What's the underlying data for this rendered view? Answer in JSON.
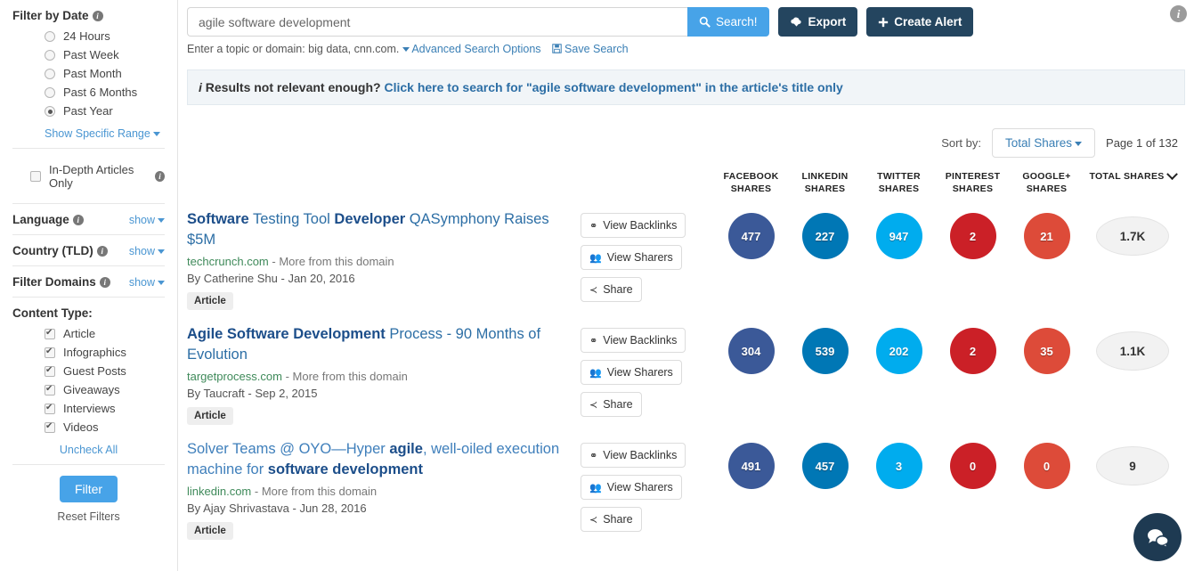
{
  "sidebar": {
    "date_filter": {
      "title": "Filter by Date",
      "options": [
        {
          "label": "24 Hours",
          "selected": false
        },
        {
          "label": "Past Week",
          "selected": false
        },
        {
          "label": "Past Month",
          "selected": false
        },
        {
          "label": "Past 6 Months",
          "selected": false
        },
        {
          "label": "Past Year",
          "selected": true
        }
      ],
      "range_link": "Show Specific Range"
    },
    "indepth": {
      "label": "In-Depth Articles Only",
      "checked": false
    },
    "language": {
      "title": "Language",
      "toggle": "show"
    },
    "country": {
      "title": "Country (TLD)",
      "toggle": "show"
    },
    "domains": {
      "title": "Filter Domains",
      "toggle": "show"
    },
    "content_type": {
      "title": "Content Type:",
      "items": [
        {
          "label": "Article",
          "checked": true
        },
        {
          "label": "Infographics",
          "checked": true
        },
        {
          "label": "Guest Posts",
          "checked": true
        },
        {
          "label": "Giveaways",
          "checked": true
        },
        {
          "label": "Interviews",
          "checked": true
        },
        {
          "label": "Videos",
          "checked": true
        }
      ],
      "uncheck_all": "Uncheck All"
    },
    "filter_button": "Filter",
    "reset_link": "Reset Filters"
  },
  "search": {
    "value": "agile software development",
    "placeholder": "Enter a topic or domain",
    "search_button": "Search!",
    "export_button": "Export",
    "create_alert_button": "Create Alert",
    "hint_text": "Enter a topic or domain: big data, cnn.com.",
    "advanced_link": "Advanced Search Options",
    "save_link": "Save Search"
  },
  "banner": {
    "prefix": "Results not relevant enough?",
    "link": "Click here to search for \"agile software development\" in the article's title only"
  },
  "toolbar": {
    "sort_label": "Sort by:",
    "sort_value": "Total Shares",
    "page_info": "Page 1 of 132"
  },
  "columns": [
    {
      "line1": "FACEBOOK",
      "line2": "SHARES"
    },
    {
      "line1": "LINKEDIN",
      "line2": "SHARES"
    },
    {
      "line1": "TWITTER",
      "line2": "SHARES"
    },
    {
      "line1": "PINTEREST",
      "line2": "SHARES"
    },
    {
      "line1": "GOOGLE+",
      "line2": "SHARES"
    }
  ],
  "total_column": "TOTAL SHARES",
  "actions": {
    "backlinks": "View Backlinks",
    "sharers": "View Sharers",
    "share": "Share"
  },
  "colors": {
    "facebook": "#3b5998",
    "linkedin": "#0077b5",
    "twitter": "#00acee",
    "pinterest": "#cb2027",
    "googleplus": "#dd4b39",
    "accent_blue": "#47a3e8",
    "dark_button": "#24455f",
    "link_blue": "#2c6ea5",
    "domain_green": "#3f8a5a",
    "chat_bubble": "#1e3a52"
  },
  "results": [
    {
      "title_parts": [
        {
          "t": "Software",
          "hl": true
        },
        {
          "t": " Testing Tool ",
          "hl": false
        },
        {
          "t": "Developer",
          "hl": true
        },
        {
          "t": " QASymphony Raises $5M",
          "hl": false
        }
      ],
      "soft": false,
      "domain": "techcrunch.com",
      "more": "- More from this domain",
      "byline": "By Catherine Shu - Jan 20, 2016",
      "badge": "Article",
      "facebook": "477",
      "linkedin": "227",
      "twitter": "947",
      "pinterest": "2",
      "googleplus": "21",
      "total": "1.7K"
    },
    {
      "title_parts": [
        {
          "t": "Agile Software Development",
          "hl": true
        },
        {
          "t": " Process - 90 Months of Evolution",
          "hl": false
        }
      ],
      "soft": false,
      "domain": "targetprocess.com",
      "more": "- More from this domain",
      "byline": "By Taucraft - Sep 2, 2015",
      "badge": "Article",
      "facebook": "304",
      "linkedin": "539",
      "twitter": "202",
      "pinterest": "2",
      "googleplus": "35",
      "total": "1.1K"
    },
    {
      "title_parts": [
        {
          "t": "Solver Teams @ OYO—Hyper ",
          "hl": false
        },
        {
          "t": "agile",
          "hl": true
        },
        {
          "t": ", well-oiled execution machine for ",
          "hl": false
        },
        {
          "t": "software development",
          "hl": true
        }
      ],
      "soft": true,
      "domain": "linkedin.com",
      "more": "- More from this domain",
      "byline": "By Ajay Shrivastava - Jun 28, 2016",
      "badge": "Article",
      "facebook": "491",
      "linkedin": "457",
      "twitter": "3",
      "pinterest": "0",
      "googleplus": "0",
      "total": "9"
    }
  ],
  "icons": {
    "search": "search-icon",
    "export": "cloud-download-icon",
    "alert": "plus-icon",
    "backlinks": "link-icon",
    "sharers": "users-icon",
    "share": "share-alt-icon",
    "info": "info-icon",
    "chat": "chat-bubbles-icon",
    "save": "floppy-disk-icon"
  }
}
